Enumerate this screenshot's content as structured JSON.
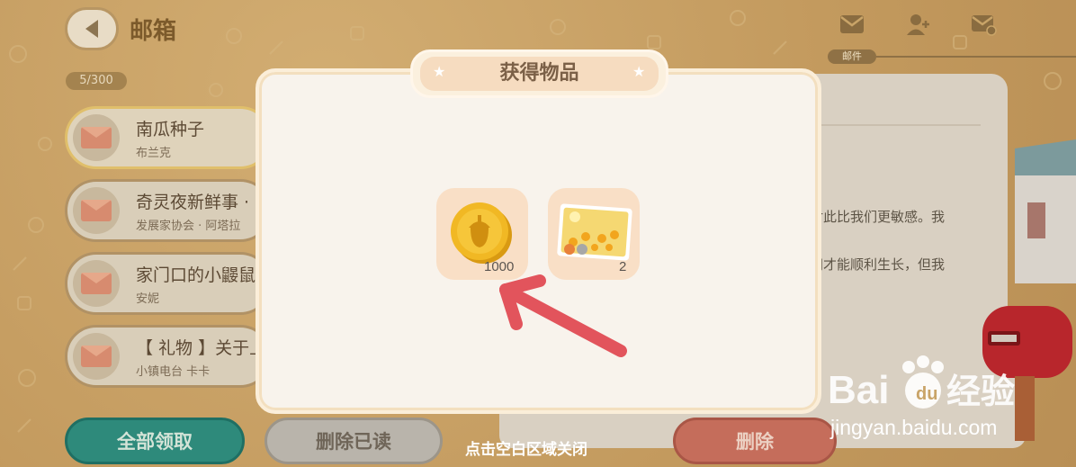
{
  "header": {
    "title": "邮箱",
    "back_icon": "back-arrow-icon"
  },
  "mail_count": "5/300",
  "mails": [
    {
      "title": "南瓜种子",
      "sender": "布兰克",
      "icon": "envelope-icon"
    },
    {
      "title": "奇灵夜新鲜事 ·",
      "sender": "发展家协会 · 阿塔拉",
      "icon": "envelope-icon"
    },
    {
      "title": "家门口的小鼹鼠",
      "sender": "安妮",
      "icon": "envelope-icon"
    },
    {
      "title": "【 礼物 】关于上",
      "sender": "小镇电台 卡卡",
      "icon": "envelope-icon"
    }
  ],
  "tabs": {
    "icons": [
      "mail-icon",
      "add-friend-icon",
      "mail-settings-icon"
    ],
    "active_label": "邮件"
  },
  "detail": {
    "line1": "对此比我们更敏感。我",
    "line2": "间才能顺利生长，但我"
  },
  "buttons": {
    "claim_all": "全部领取",
    "delete_read": "删除已读",
    "delete": "删除"
  },
  "hint": "点击空白区域关闭",
  "modal": {
    "title": "获得物品",
    "rewards": [
      {
        "name": "acorn-coin-icon",
        "quantity": "1000"
      },
      {
        "name": "sunflower-cats-postcard-icon",
        "quantity": "2"
      }
    ]
  },
  "watermark": {
    "logo": "Baidu经验",
    "url": "jingyan.baidu.com"
  },
  "colors": {
    "background": "#c9a468",
    "modal_bg": "#f8f3ec",
    "tile_bg": "#f9dfc6",
    "claim_button": "#2e8a7b",
    "delete_button": "#c56d5b",
    "arrow": "#e2545c",
    "coin": "#f1b824"
  }
}
